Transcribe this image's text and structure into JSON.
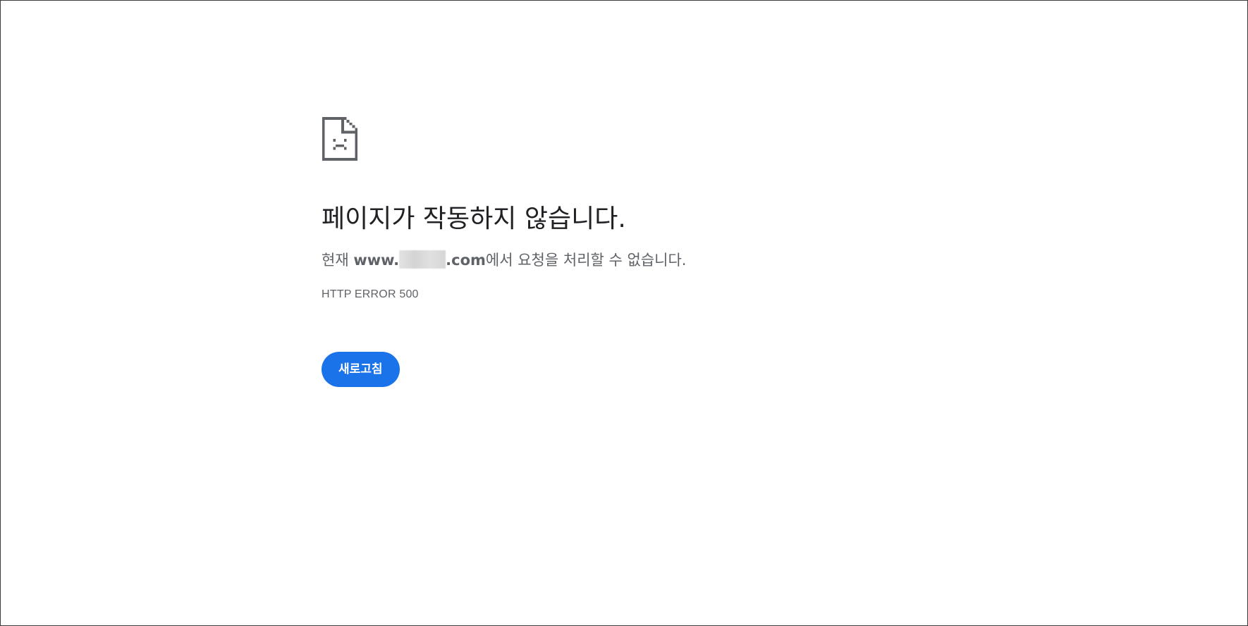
{
  "error_page": {
    "icon": "sad-document-icon",
    "title": "페이지가 작동하지 않습니다.",
    "description_prefix": "현재 ",
    "host_prefix": "www.",
    "host_suffix": ".com",
    "description_suffix": "에서 요청을 처리할 수 없습니다.",
    "error_code": "HTTP ERROR 500",
    "reload_label": "새로고침"
  },
  "colors": {
    "title": "#202124",
    "text": "#5f6368",
    "button": "#1a73e8",
    "icon": "#5f6368"
  }
}
